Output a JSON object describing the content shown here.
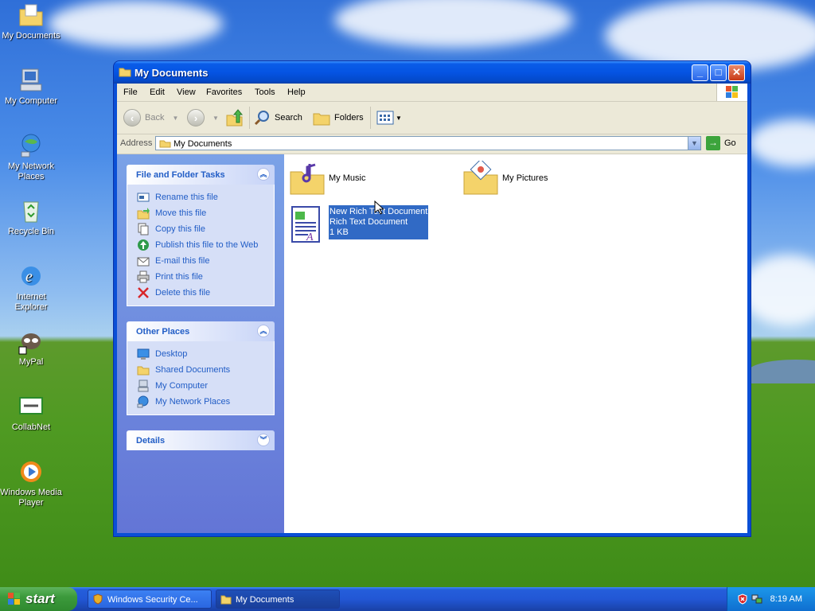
{
  "desktop": {
    "icons": [
      {
        "label": "My Documents"
      },
      {
        "label": "My Computer"
      },
      {
        "label": "My Network Places"
      },
      {
        "label": "Recycle Bin"
      },
      {
        "label": "Internet Explorer"
      },
      {
        "label": "MyPal"
      },
      {
        "label": "CollabNet"
      },
      {
        "label": "Windows Media Player"
      }
    ]
  },
  "window": {
    "title": "My Documents",
    "controls": {
      "minimize": "_",
      "maximize": "□",
      "close": "✕"
    },
    "menu": [
      "File",
      "Edit",
      "View",
      "Favorites",
      "Tools",
      "Help"
    ],
    "toolbar": {
      "back": "Back",
      "search": "Search",
      "folders": "Folders"
    },
    "address": {
      "label": "Address",
      "value": "My Documents",
      "go": "Go"
    },
    "tasks": {
      "file_folder_title": "File and Folder Tasks",
      "file_folder_items": [
        "Rename this file",
        "Move this file",
        "Copy this file",
        "Publish this file to the Web",
        "E-mail this file",
        "Print this file",
        "Delete this file"
      ],
      "other_places_title": "Other Places",
      "other_places_items": [
        "Desktop",
        "Shared Documents",
        "My Computer",
        "My Network Places"
      ],
      "details_title": "Details"
    },
    "files": [
      {
        "name": "My Music"
      },
      {
        "name": "My Pictures"
      },
      {
        "name": "New Rich Text Document",
        "type": "Rich Text Document",
        "size": "1 KB"
      }
    ]
  },
  "taskbar": {
    "start": "start",
    "buttons": [
      "Windows Security Ce...",
      "My Documents"
    ],
    "clock": "8:19 AM"
  },
  "colors": {
    "selection": "#316ac5",
    "task_link": "#215dc6",
    "titlebar": "#0554e3"
  }
}
